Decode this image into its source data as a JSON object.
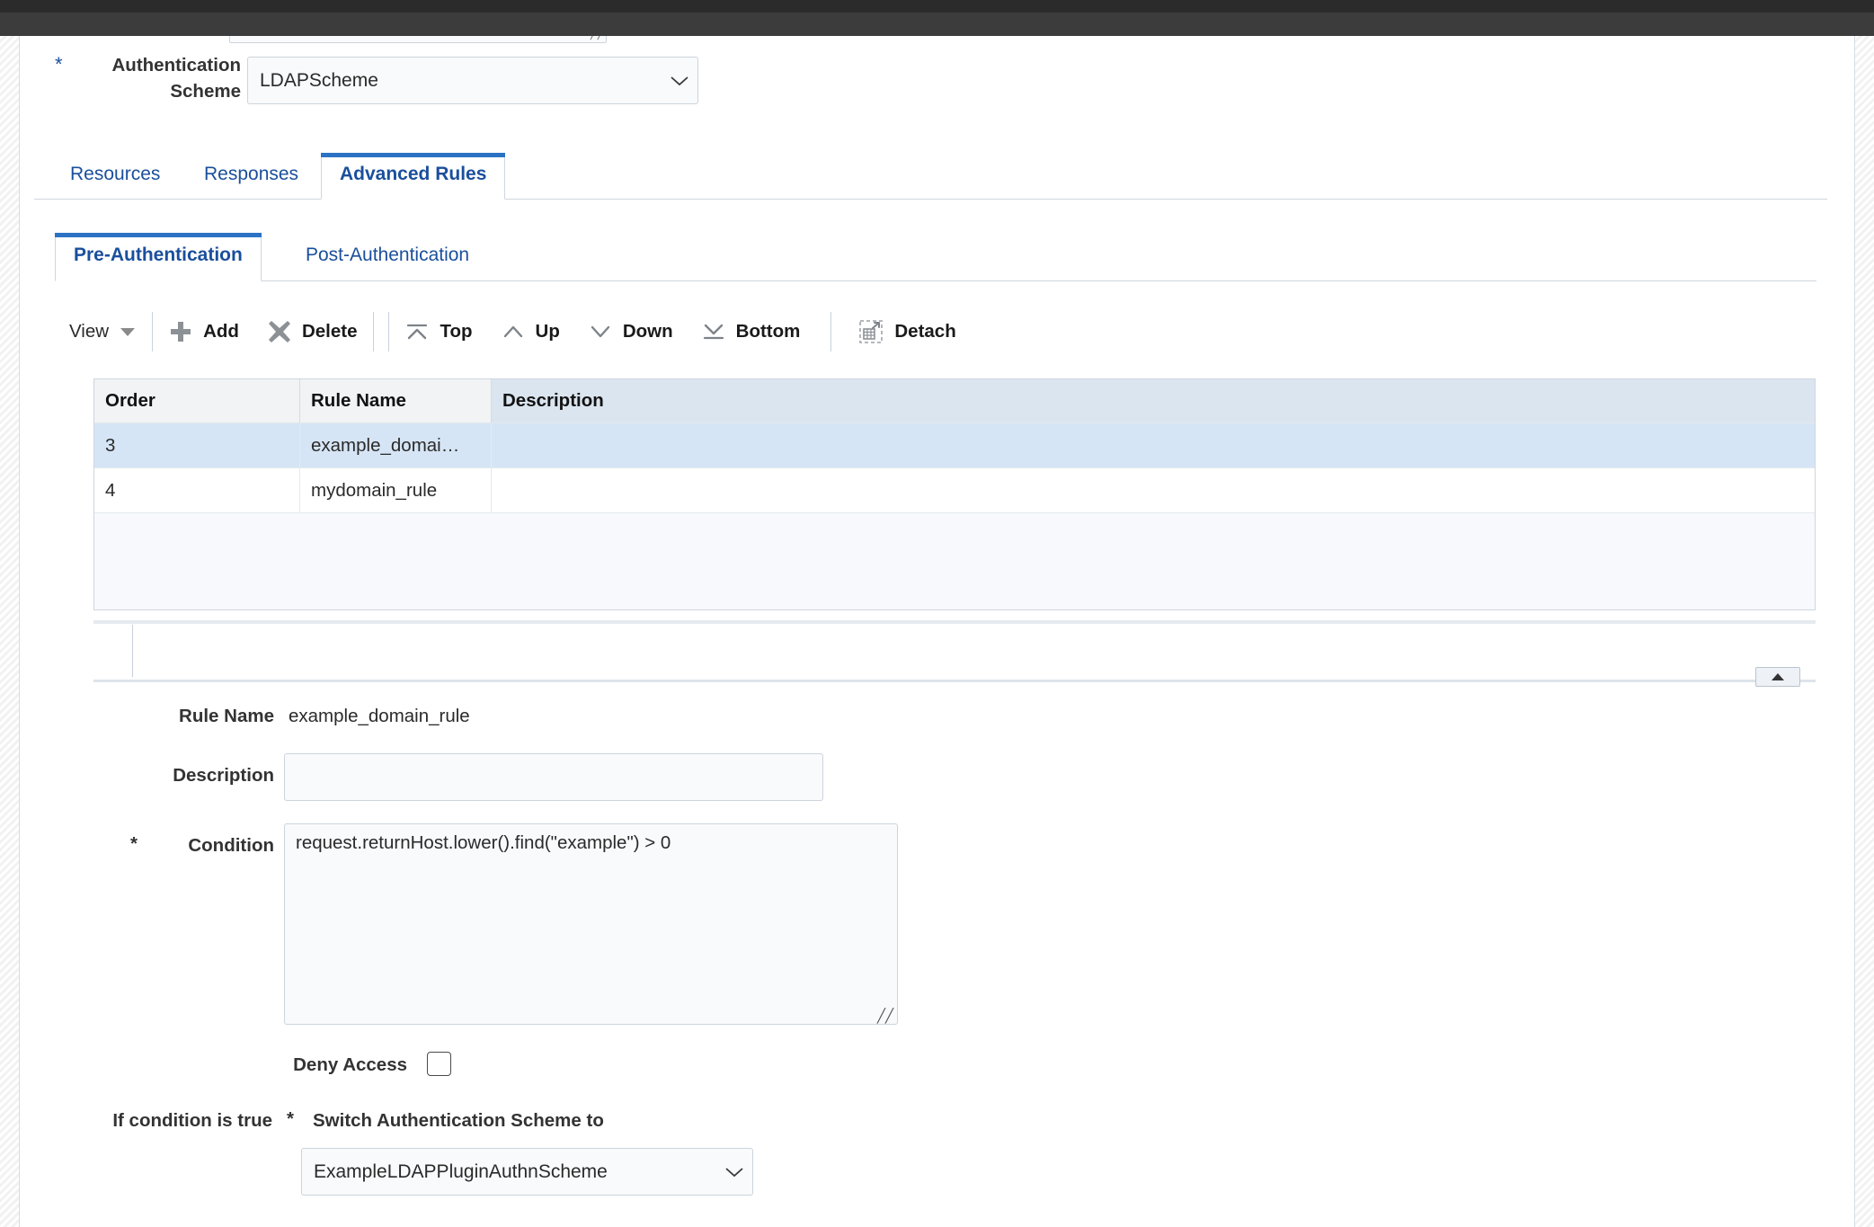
{
  "auth_scheme": {
    "label": "Authentication Scheme",
    "value": "LDAPScheme",
    "required_marker": "*",
    "chevron_icon": "chevron-down-icon"
  },
  "tabs_level1": [
    {
      "label": "Resources",
      "active": false
    },
    {
      "label": "Responses",
      "active": false
    },
    {
      "label": "Advanced Rules",
      "active": true
    }
  ],
  "tabs_level2": [
    {
      "label": "Pre-Authentication",
      "active": true
    },
    {
      "label": "Post-Authentication",
      "active": false
    }
  ],
  "toolbar": {
    "view_label": "View",
    "view_caret_icon": "caret-down-icon",
    "add_label": "Add",
    "add_icon": "plus-icon",
    "delete_label": "Delete",
    "delete_icon": "x-mark-icon",
    "top_label": "Top",
    "top_icon": "move-to-top-icon",
    "up_label": "Up",
    "up_icon": "chevron-up-icon",
    "down_label": "Down",
    "down_icon": "chevron-down-icon",
    "bottom_label": "Bottom",
    "bottom_icon": "move-to-bottom-icon",
    "detach_label": "Detach",
    "detach_icon": "detach-grid-icon"
  },
  "table": {
    "columns": [
      "Order",
      "Rule Name",
      "Description"
    ],
    "rows": [
      {
        "order": "3",
        "rule_name": "example_domai…",
        "description": "",
        "selected": true
      },
      {
        "order": "4",
        "rule_name": "mydomain_rule",
        "description": "",
        "selected": false
      }
    ]
  },
  "splitter": {
    "collapse_icon": "triangle-up-icon"
  },
  "detail": {
    "rule_name_label": "Rule Name",
    "rule_name_value": "example_domain_rule",
    "description_label": "Description",
    "description_value": "",
    "description_placeholder": "",
    "condition_label": "Condition",
    "condition_required_marker": "*",
    "condition_value": "request.returnHost.lower().find(\"example\") > 0",
    "resize_grip_icon": "resize-grip-icon",
    "deny_access_label": "Deny Access",
    "deny_access_checked": false,
    "if_condition_label": "If condition is true",
    "switch_scheme_label": "Switch Authentication Scheme to",
    "switch_scheme_required_marker": "*",
    "switch_scheme_value": "ExampleLDAPPluginAuthnScheme",
    "switch_scheme_chevron_icon": "chevron-down-icon"
  },
  "colors": {
    "accent": "#2b71c4",
    "link": "#1a4f9c",
    "row_selected": "#d6e5f5",
    "header_desc": "#dbe5f0",
    "header_grey": "#f1f3f5",
    "border": "#cfd6de"
  }
}
